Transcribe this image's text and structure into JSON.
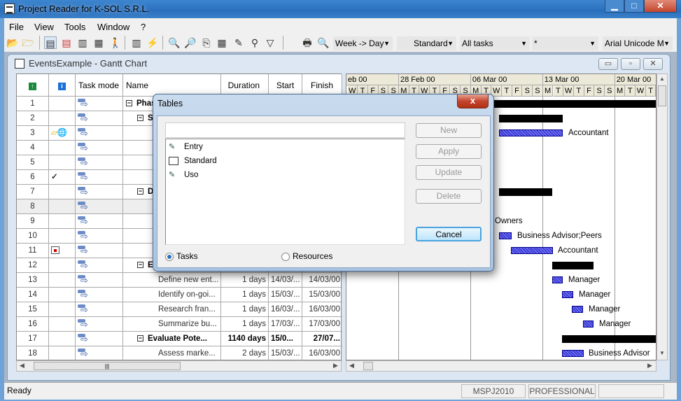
{
  "app": {
    "title": "Project Reader for K-SOL S.R.L."
  },
  "menu": [
    "File",
    "View",
    "Tools",
    "Window",
    "?"
  ],
  "toolbar": {
    "zoom_combo": "Week -> Day",
    "table_combo": "Standard",
    "filter_combo": "All tasks",
    "group_combo": "*",
    "font_combo": "Arial Unicode MS"
  },
  "child": {
    "title": "EventsExample - Gantt Chart",
    "minimize": "▭",
    "restore": "▫",
    "close": "✕"
  },
  "columns": {
    "mode": "Task mode",
    "name": "Name",
    "duration": "Duration",
    "start": "Start",
    "finish": "Finish"
  },
  "rows": [
    {
      "id": "1",
      "name": "Phas",
      "summary": true,
      "level": 0,
      "indicator": ""
    },
    {
      "id": "2",
      "name": "S",
      "summary": true,
      "level": 1,
      "indicator": ""
    },
    {
      "id": "3",
      "name": "",
      "level": 2,
      "indicator": "note-link"
    },
    {
      "id": "4",
      "name": "",
      "level": 2,
      "indicator": ""
    },
    {
      "id": "5",
      "name": "",
      "level": 2,
      "indicator": ""
    },
    {
      "id": "6",
      "name": "",
      "level": 2,
      "indicator": "✓"
    },
    {
      "id": "7",
      "name": "D",
      "summary": true,
      "level": 1,
      "indicator": ""
    },
    {
      "id": "8",
      "name": "",
      "level": 2,
      "indicator": ""
    },
    {
      "id": "9",
      "name": "",
      "level": 2,
      "indicator": ""
    },
    {
      "id": "10",
      "name": "",
      "level": 2,
      "indicator": ""
    },
    {
      "id": "11",
      "name": "",
      "level": 2,
      "indicator": "calendar"
    },
    {
      "id": "12",
      "name": "E",
      "summary": true,
      "level": 1,
      "indicator": ""
    },
    {
      "id": "13",
      "name": "Define new ent...",
      "duration": "1 days",
      "start": "14/03/...",
      "finish": "14/03/00",
      "level": 2
    },
    {
      "id": "14",
      "name": "Identify on-goi...",
      "duration": "1 days",
      "start": "15/03/...",
      "finish": "15/03/00",
      "level": 2
    },
    {
      "id": "15",
      "name": "Research fran...",
      "duration": "1 days",
      "start": "16/03/...",
      "finish": "16/03/00",
      "level": 2
    },
    {
      "id": "16",
      "name": "Summarize bu...",
      "duration": "1 days",
      "start": "17/03/...",
      "finish": "17/03/00",
      "level": 2
    },
    {
      "id": "17",
      "name": "Evaluate Pote...",
      "duration": "1140 days",
      "start": "15/0...",
      "finish": "27/07...",
      "summary": true,
      "level": 1
    },
    {
      "id": "18",
      "name": "Assess marke...",
      "duration": "2 days",
      "start": "15/03/...",
      "finish": "16/03/00",
      "level": 2
    }
  ],
  "timescale": {
    "weeks": [
      "eb 00",
      "28 Feb 00",
      "06 Mar 00",
      "13 Mar 00",
      "20 Mar 00"
    ],
    "partial_days": [
      "W",
      "T",
      "F",
      "S",
      "S"
    ],
    "days": [
      "M",
      "T",
      "W",
      "T",
      "F",
      "S",
      "S"
    ]
  },
  "gantt_labels": {
    "r3": "Accountant",
    "r9": "Owners",
    "r10": "Business Advisor;Peers",
    "r11": "Accountant",
    "r13": "Manager",
    "r14": "Manager",
    "r15": "Manager",
    "r16": "Manager",
    "r18": "Business Advisor"
  },
  "dialog": {
    "title": "Tables",
    "close": "x",
    "input_value": "",
    "items": [
      "Entry",
      "Standard",
      "Uso"
    ],
    "buttons": {
      "new": "New",
      "apply": "Apply",
      "update": "Update",
      "delete": "Delete",
      "cancel": "Cancel"
    },
    "radio_tasks": "Tasks",
    "radio_resources": "Resources",
    "selected": "Tasks"
  },
  "status": {
    "text": "Ready",
    "version": "MSPJ2010",
    "edition": "PROFESSIONAL"
  }
}
